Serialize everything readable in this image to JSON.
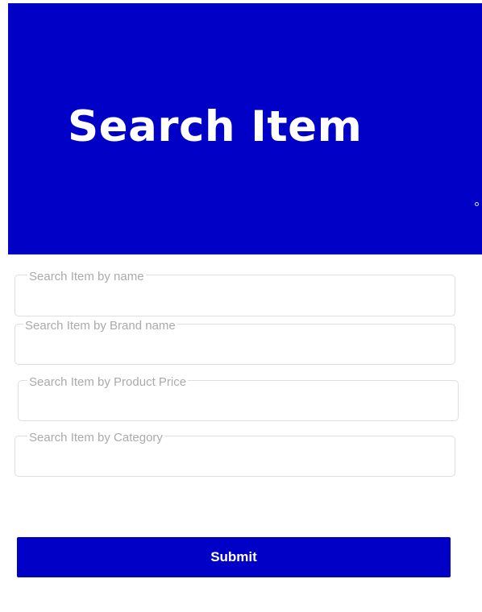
{
  "header": {
    "title": "Search Item"
  },
  "form": {
    "fields": [
      {
        "label": "Search Item by name",
        "value": ""
      },
      {
        "label": "Search Item by Brand name",
        "value": ""
      },
      {
        "label": "Search Item by Product Price",
        "value": ""
      },
      {
        "label": "Search Item by Category",
        "value": ""
      }
    ],
    "submit_label": "Submit"
  },
  "colors": {
    "primary": "#0000c6",
    "background": "#ffffff",
    "field_border": "#dedede",
    "label_text": "#aaaaaa"
  }
}
